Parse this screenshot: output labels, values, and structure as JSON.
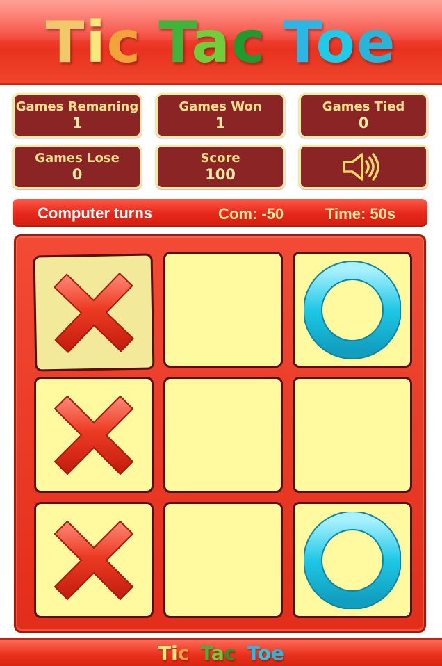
{
  "header": {
    "title_words": [
      "Tic",
      "Tac",
      "Toe"
    ]
  },
  "stats": {
    "games_remaining": {
      "label": "Games Remaning",
      "value": "1"
    },
    "games_won": {
      "label": "Games Won",
      "value": "1"
    },
    "games_tied": {
      "label": "Games Tied",
      "value": "0"
    },
    "games_lose": {
      "label": "Games Lose",
      "value": "0"
    },
    "score": {
      "label": "Score",
      "value": "100"
    },
    "sound": {
      "icon": "speaker-icon"
    }
  },
  "status": {
    "turn": "Computer turns",
    "com": "Com: -50",
    "time": "Time: 50s"
  },
  "board": {
    "cells": [
      "X",
      "",
      "O",
      "X",
      "",
      "",
      "X",
      "",
      "O"
    ],
    "highlighted_cell": 0
  },
  "footer": {
    "title_words": [
      "Tic",
      "Tac",
      "Toe"
    ]
  },
  "colors": {
    "header_red": "#f6463a",
    "stat_box": "#8b2424",
    "stat_text": "#f7e08a",
    "cell_bg": "#fff9a0",
    "x_red": "#e0301c",
    "o_cyan": "#1ec8e6"
  }
}
